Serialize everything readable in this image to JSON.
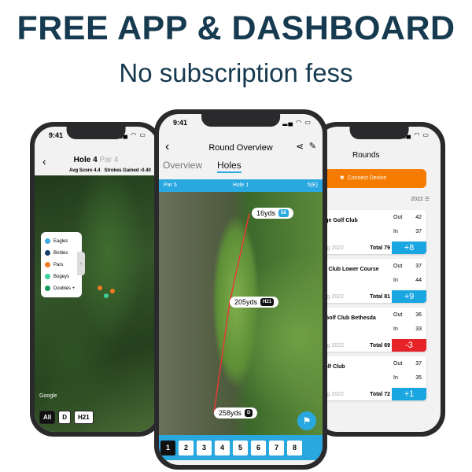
{
  "headline": "FREE APP & DASHBOARD",
  "subheadline": "No subscription fess",
  "status_time": "9:41",
  "left_phone": {
    "title": "Hole 4",
    "par": "Par 4",
    "avg_score": "Avg Score 4.4",
    "strokes_gained": "Strokes Gained -0.40",
    "legend": [
      {
        "label": "Eagles",
        "color": "#3fa9e0"
      },
      {
        "label": "Birdies",
        "color": "#143f6b"
      },
      {
        "label": "Pars",
        "color": "#f57c1f"
      },
      {
        "label": "Bogeys",
        "color": "#3fcf98"
      },
      {
        "label": "Doubles +",
        "color": "#139a5a"
      }
    ],
    "map_credit": "Google",
    "filters": [
      "All",
      "D",
      "H21"
    ]
  },
  "mid_phone": {
    "title": "Round Overview",
    "tabs": [
      "Overview",
      "Holes"
    ],
    "active_tab": "Holes",
    "bar": {
      "par": "Par 5",
      "hole": "Hole 1",
      "score": "5(E)"
    },
    "markers": [
      {
        "dist": "16yds",
        "badge": "58"
      },
      {
        "dist": "205yds",
        "badge": "H21"
      },
      {
        "dist": "258yds",
        "badge": "D"
      }
    ],
    "holes": [
      "1",
      "2",
      "3",
      "4",
      "5",
      "6",
      "7",
      "8"
    ],
    "active_hole": "1",
    "accent": "#29a8e0"
  },
  "right_phone": {
    "title": "Rounds",
    "connect_label": "Connect Device",
    "year": "2022",
    "accent": "#f57c00",
    "rounds": [
      {
        "name": "idge Golf Club",
        "out": "42",
        "in": "37",
        "date": "Aug 2022",
        "total": "Total 79",
        "score": "+8",
        "color": "#1aa6e0"
      },
      {
        "name": "olf Club Lower Course",
        "out": "37",
        "in": "44",
        "date": "Aug 2022",
        "total": "Total 81",
        "score": "+9",
        "color": "#1aa6e0"
      },
      {
        "name": "s Golf Club Bethesda",
        "out": "36",
        "in": "33",
        "date": "Aug 2022",
        "total": "Total 69",
        "score": "-3",
        "color": "#e52329"
      },
      {
        "name": "Golf Club",
        "out": "37",
        "in": "35",
        "date": "Aug 2022",
        "total": "Total 72",
        "score": "+1",
        "color": "#1aa6e0"
      }
    ],
    "out_label": "Out",
    "in_label": "In"
  }
}
